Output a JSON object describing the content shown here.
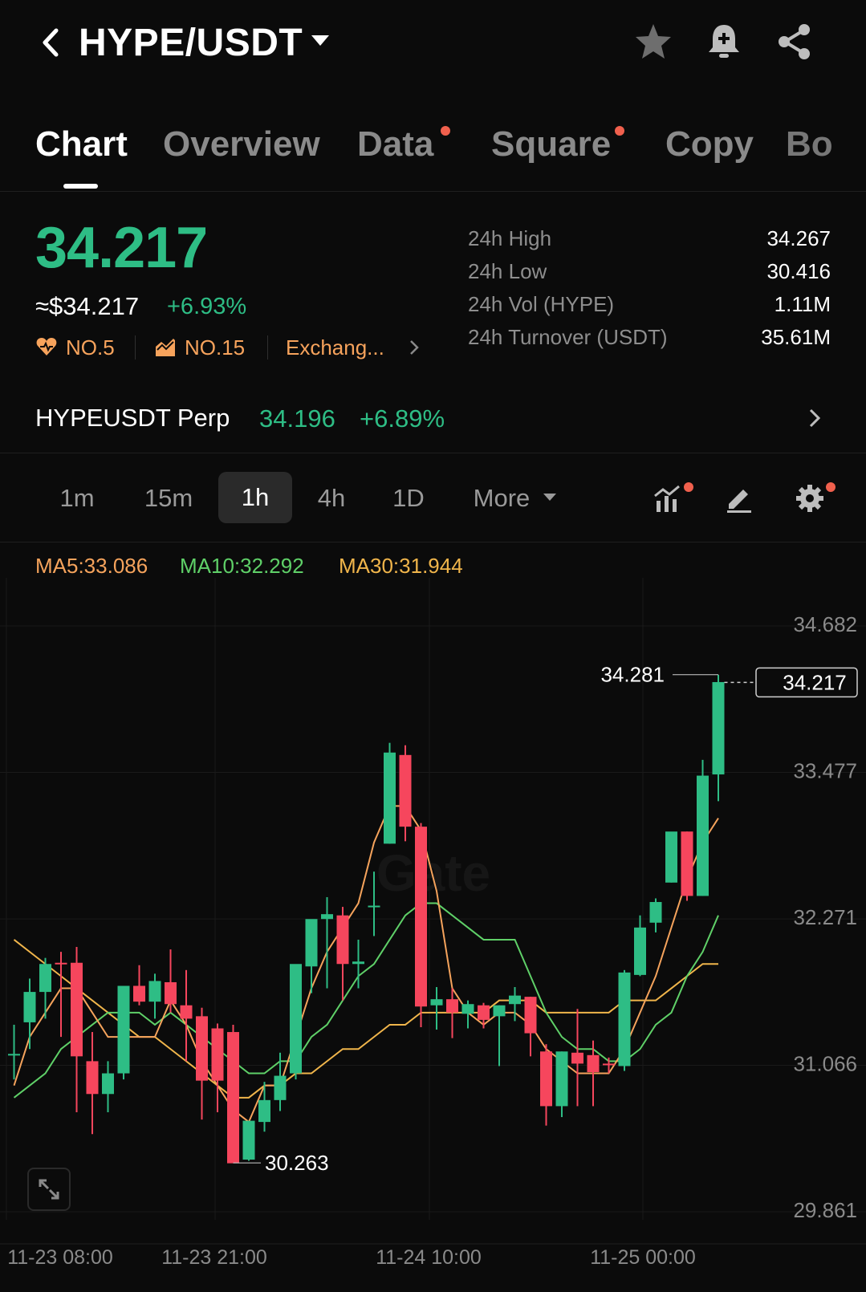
{
  "header": {
    "title": "HYPE/USDT"
  },
  "tabs": [
    {
      "label": "Chart",
      "active": true,
      "dot": false
    },
    {
      "label": "Overview",
      "active": false,
      "dot": false
    },
    {
      "label": "Data",
      "active": false,
      "dot": true
    },
    {
      "label": "Square",
      "active": false,
      "dot": true
    },
    {
      "label": "Copy",
      "active": false,
      "dot": false
    },
    {
      "label": "Bo",
      "active": false,
      "dot": false
    }
  ],
  "price": {
    "last": "34.217",
    "approx_usd": "≈$34.217",
    "change_pct": "+6.93%",
    "rank_hot": "NO.5",
    "rank_gain": "NO.15",
    "exchange_link": "Exchang..."
  },
  "stats": {
    "high_label": "24h High",
    "high_value": "34.267",
    "low_label": "24h Low",
    "low_value": "30.416",
    "vol_label": "24h Vol (HYPE)",
    "vol_value": "1.11M",
    "turnover_label": "24h Turnover (USDT)",
    "turnover_value": "35.61M"
  },
  "perp": {
    "name": "HYPEUSDT Perp",
    "price": "34.196",
    "change": "+6.89%"
  },
  "intervals": {
    "items": [
      "1m",
      "15m",
      "1h",
      "4h",
      "1D"
    ],
    "active": "1h",
    "more_label": "More"
  },
  "ma": {
    "ma5": "MA5:33.086",
    "ma10": "MA10:32.292",
    "ma30": "MA30:31.944"
  },
  "colors": {
    "up": "#2ebd85",
    "down": "#f6465d",
    "ma5": "#f5a35c",
    "ma10": "#5fd068",
    "ma30": "#f0b54b",
    "accent_dot": "#f0604d"
  },
  "chart_data": {
    "type": "candlestick",
    "interval": "1h",
    "y_ticks": [
      "34.682",
      "33.477",
      "32.271",
      "31.066",
      "29.861"
    ],
    "ylim": [
      29.861,
      34.682
    ],
    "x_ticks": [
      "11-23 08:00",
      "11-23 21:00",
      "11-24 10:00",
      "11-25 00:00"
    ],
    "last_price_label": "34.217",
    "high_marker": "34.281",
    "low_marker": "30.263",
    "candles": [
      {
        "o": 31.15,
        "h": 31.4,
        "l": 30.95,
        "c": 31.16
      },
      {
        "o": 31.42,
        "h": 31.78,
        "l": 31.2,
        "c": 31.67
      },
      {
        "o": 31.67,
        "h": 31.95,
        "l": 31.45,
        "c": 31.9
      },
      {
        "o": 31.91,
        "h": 32.0,
        "l": 31.3,
        "c": 31.9
      },
      {
        "o": 31.91,
        "h": 32.04,
        "l": 30.68,
        "c": 31.14
      },
      {
        "o": 31.1,
        "h": 31.34,
        "l": 30.5,
        "c": 30.83
      },
      {
        "o": 30.83,
        "h": 31.1,
        "l": 30.68,
        "c": 31.0
      },
      {
        "o": 31.0,
        "h": 31.7,
        "l": 30.95,
        "c": 31.72
      },
      {
        "o": 31.72,
        "h": 31.89,
        "l": 31.56,
        "c": 31.59
      },
      {
        "o": 31.59,
        "h": 31.82,
        "l": 31.45,
        "c": 31.76
      },
      {
        "o": 31.75,
        "h": 32.02,
        "l": 31.5,
        "c": 31.57
      },
      {
        "o": 31.56,
        "h": 31.85,
        "l": 31.1,
        "c": 31.45
      },
      {
        "o": 31.47,
        "h": 31.54,
        "l": 30.62,
        "c": 30.94
      },
      {
        "o": 31.37,
        "h": 31.41,
        "l": 30.68,
        "c": 30.94
      },
      {
        "o": 31.34,
        "h": 31.4,
        "l": 30.33,
        "c": 30.26
      },
      {
        "o": 30.29,
        "h": 30.5,
        "l": 30.28,
        "c": 30.61
      },
      {
        "o": 30.6,
        "h": 30.93,
        "l": 30.52,
        "c": 30.78
      },
      {
        "o": 30.78,
        "h": 31.17,
        "l": 30.69,
        "c": 30.98
      },
      {
        "o": 31.0,
        "h": 31.64,
        "l": 30.95,
        "c": 31.9
      },
      {
        "o": 31.88,
        "h": 32.2,
        "l": 31.66,
        "c": 32.27
      },
      {
        "o": 32.27,
        "h": 32.45,
        "l": 31.7,
        "c": 32.31
      },
      {
        "o": 32.3,
        "h": 32.37,
        "l": 31.6,
        "c": 31.9
      },
      {
        "o": 31.9,
        "h": 32.1,
        "l": 31.7,
        "c": 31.92
      },
      {
        "o": 32.38,
        "h": 32.66,
        "l": 32.13,
        "c": 32.38
      },
      {
        "o": 32.89,
        "h": 33.72,
        "l": 32.89,
        "c": 33.64
      },
      {
        "o": 33.62,
        "h": 33.7,
        "l": 32.91,
        "c": 33.03
      },
      {
        "o": 33.03,
        "h": 33.06,
        "l": 31.38,
        "c": 31.55
      },
      {
        "o": 31.56,
        "h": 31.71,
        "l": 31.36,
        "c": 31.61
      },
      {
        "o": 31.61,
        "h": 31.7,
        "l": 31.29,
        "c": 31.5
      },
      {
        "o": 31.49,
        "h": 31.6,
        "l": 31.37,
        "c": 31.57
      },
      {
        "o": 31.56,
        "h": 31.58,
        "l": 31.37,
        "c": 31.44
      },
      {
        "o": 31.47,
        "h": 31.56,
        "l": 31.06,
        "c": 31.56
      },
      {
        "o": 31.57,
        "h": 31.71,
        "l": 31.43,
        "c": 31.64
      },
      {
        "o": 31.63,
        "h": 31.63,
        "l": 31.14,
        "c": 31.33
      },
      {
        "o": 31.18,
        "h": 31.24,
        "l": 30.57,
        "c": 30.73
      },
      {
        "o": 30.73,
        "h": 31.18,
        "l": 30.64,
        "c": 31.18
      },
      {
        "o": 31.17,
        "h": 31.53,
        "l": 30.73,
        "c": 31.08
      },
      {
        "o": 31.15,
        "h": 31.27,
        "l": 30.73,
        "c": 31.01
      },
      {
        "o": 31.08,
        "h": 31.13,
        "l": 31.0,
        "c": 31.07
      },
      {
        "o": 31.06,
        "h": 31.85,
        "l": 31.02,
        "c": 31.83
      },
      {
        "o": 31.81,
        "h": 32.3,
        "l": 31.8,
        "c": 32.2
      },
      {
        "o": 32.24,
        "h": 32.44,
        "l": 32.16,
        "c": 32.41
      },
      {
        "o": 32.57,
        "h": 32.63,
        "l": 32.57,
        "c": 32.99
      },
      {
        "o": 32.99,
        "h": 32.99,
        "l": 32.42,
        "c": 32.46
      },
      {
        "o": 32.46,
        "h": 33.58,
        "l": 32.46,
        "c": 33.45
      },
      {
        "o": 33.46,
        "h": 34.28,
        "l": 33.24,
        "c": 34.22
      }
    ],
    "ma5": [
      30.9,
      31.3,
      31.5,
      31.7,
      31.7,
      31.5,
      31.3,
      31.3,
      31.3,
      31.3,
      31.6,
      31.4,
      31.1,
      30.9,
      30.7,
      30.6,
      30.9,
      30.9,
      31.3,
      31.7,
      32.0,
      32.2,
      32.4,
      32.9,
      33.2,
      33.2,
      33.0,
      32.5,
      31.7,
      31.5,
      31.4,
      31.5,
      31.5,
      31.4,
      31.2,
      31.1,
      31.0,
      31.0,
      31.0,
      31.2,
      31.5,
      31.8,
      32.2,
      32.6,
      32.9,
      33.1
    ],
    "ma10": [
      30.8,
      30.9,
      31.0,
      31.2,
      31.3,
      31.4,
      31.5,
      31.5,
      31.5,
      31.4,
      31.5,
      31.4,
      31.3,
      31.2,
      31.1,
      31.0,
      31.0,
      31.1,
      31.1,
      31.3,
      31.4,
      31.6,
      31.8,
      31.9,
      32.1,
      32.3,
      32.4,
      32.4,
      32.3,
      32.2,
      32.1,
      32.1,
      32.1,
      31.8,
      31.5,
      31.3,
      31.2,
      31.2,
      31.1,
      31.1,
      31.2,
      31.4,
      31.5,
      31.8,
      32.0,
      32.3
    ],
    "ma30": [
      32.1,
      32.0,
      31.9,
      31.8,
      31.7,
      31.6,
      31.5,
      31.4,
      31.3,
      31.3,
      31.2,
      31.1,
      31.0,
      30.9,
      30.8,
      30.8,
      30.9,
      30.9,
      31.0,
      31.0,
      31.1,
      31.2,
      31.2,
      31.3,
      31.4,
      31.4,
      31.5,
      31.5,
      31.5,
      31.5,
      31.5,
      31.6,
      31.6,
      31.6,
      31.5,
      31.5,
      31.5,
      31.5,
      31.5,
      31.6,
      31.6,
      31.6,
      31.7,
      31.8,
      31.9,
      31.9
    ]
  }
}
